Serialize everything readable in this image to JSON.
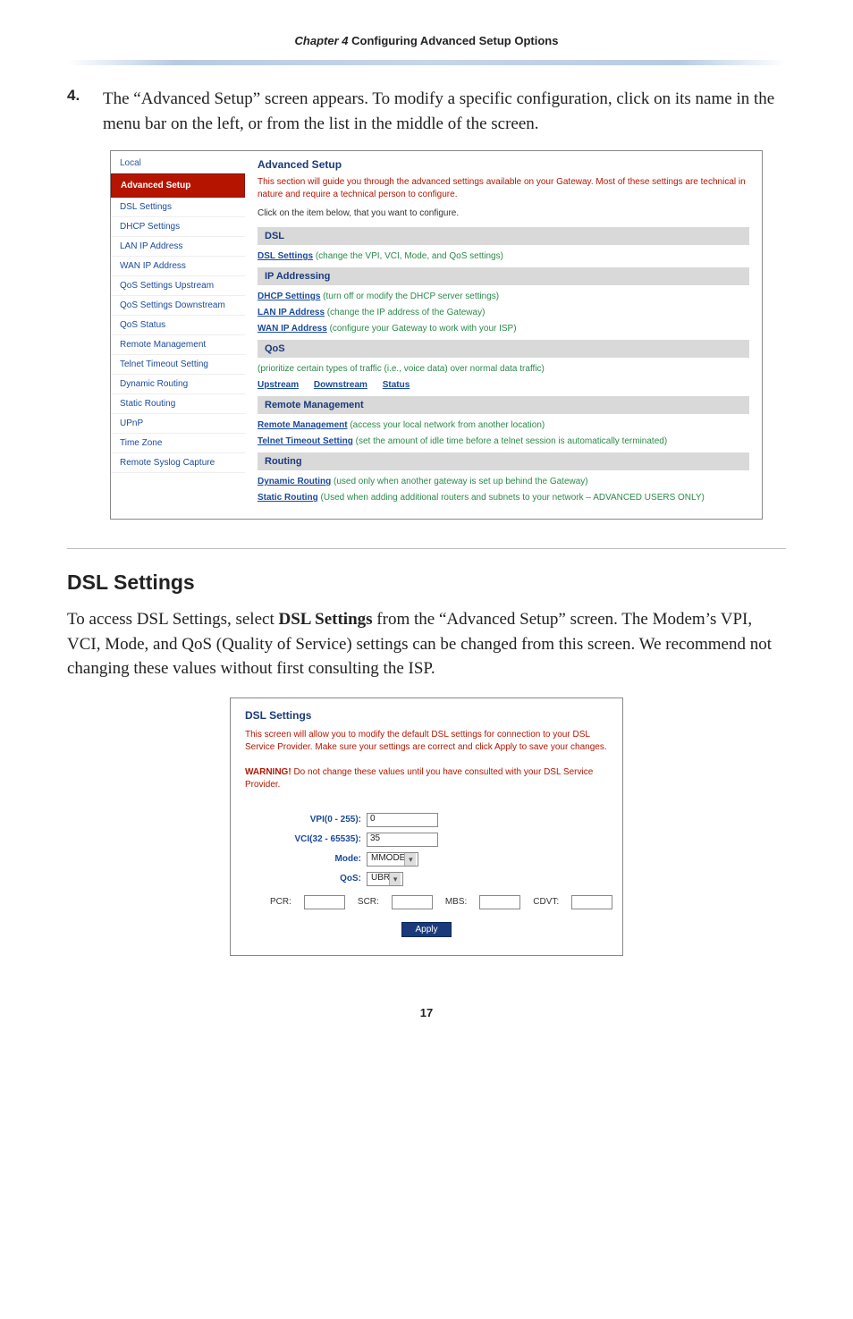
{
  "chapter": {
    "num": "Chapter 4",
    "title": " Configuring Advanced Setup Options"
  },
  "step": {
    "num": "4.",
    "text": "The “Advanced Setup” screen appears. To modify a specific configuration, click on its name in the menu bar on the left, or from the list in the middle of the screen."
  },
  "sidebar": {
    "items": [
      "Local",
      "Advanced Setup",
      "DSL Settings",
      "DHCP Settings",
      "LAN IP Address",
      "WAN IP Address",
      "QoS Settings Upstream",
      "QoS Settings Downstream",
      "QoS Status",
      "Remote Management",
      "Telnet Timeout Setting",
      "Dynamic Routing",
      "Static Routing",
      "UPnP",
      "Time Zone",
      "Remote Syslog Capture"
    ]
  },
  "adv": {
    "title": "Advanced Setup",
    "intro_red": "This section will guide you through the advanced settings available on your Gateway. Most of these settings are technical in nature and require a technical person to configure.",
    "intro_plain": "Click on the item below, that you want to configure.",
    "dsl_head": "DSL",
    "dsl_link": "DSL Settings",
    "dsl_desc": " (change the VPI, VCI, Mode, and QoS settings)",
    "ip_head": "IP Addressing",
    "dhcp_link": "DHCP Settings",
    "dhcp_desc": " (turn off or modify the DHCP server settings)",
    "lan_link": "LAN IP Address",
    "lan_desc": " (change the IP address of the Gateway)",
    "wan_link": "WAN IP Address",
    "wan_desc": " (configure your Gateway to work with your ISP)",
    "qos_head": "QoS",
    "qos_desc": "(prioritize certain types of traffic (i.e., voice data) over normal data traffic)",
    "qos_up": "Upstream",
    "qos_down": "Downstream",
    "qos_stat": "Status",
    "rm_head": "Remote Management",
    "rm_link": "Remote Management",
    "rm_desc": " (access your local network from another location)",
    "tt_link": "Telnet Timeout Setting",
    "tt_desc": " (set the amount of idle time before a telnet session is automatically terminated)",
    "rt_head": "Routing",
    "dr_link": "Dynamic Routing",
    "dr_desc": " (used only when another gateway is set up behind the Gateway)",
    "sr_link": "Static Routing",
    "sr_desc": " (Used when adding additional routers and subnets to your network – ADVANCED USERS ONLY)"
  },
  "section": {
    "title": "DSL Settings",
    "para": "To access DSL Settings, select DSL Settings from the “Advanced Setup” screen. The Modem’s VPI, VCI, Mode, and QoS (Quality of Service) settings can be changed from this screen. We recommend not changing these values without first consulting the ISP."
  },
  "dsl": {
    "title": "DSL Settings",
    "intro1": "This screen will allow you to modify the default DSL settings for connection to your DSL Service Provider. Make sure your settings are correct and click Apply to save your changes.",
    "warn_label": "WARNING!",
    "warn_rest": " Do not change these values until you have consulted with your DSL Service Provider.",
    "vpi_label": "VPI(0 - 255):",
    "vpi_val": "0",
    "vci_label": "VCI(32 - 65535):",
    "vci_val": "35",
    "mode_label": "Mode:",
    "mode_val": "MMODE",
    "qos_label": "QoS:",
    "qos_val": "UBR",
    "pcr": "PCR:",
    "scr": "SCR:",
    "mbs": "MBS:",
    "cdvt": "CDVT:",
    "apply": "Apply"
  },
  "page_num": "17"
}
